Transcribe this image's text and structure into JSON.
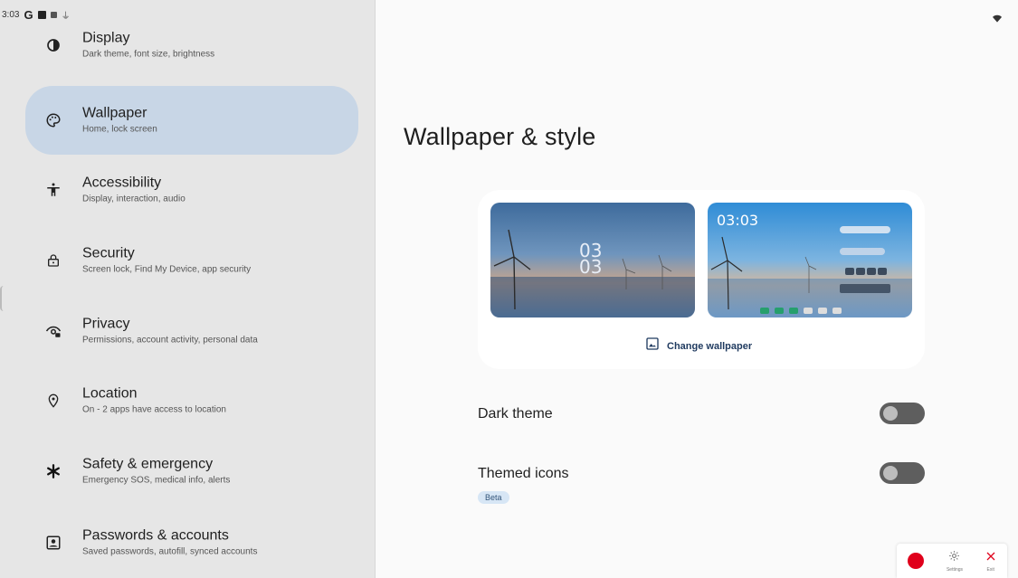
{
  "status_bar": {
    "time": "3:03",
    "g_label": "G"
  },
  "nav": {
    "items": [
      {
        "title": "Display",
        "subtitle": "Dark theme, font size, brightness",
        "icon": "brightness-icon"
      },
      {
        "title": "Wallpaper",
        "subtitle": "Home, lock screen",
        "icon": "palette-icon",
        "active": true
      },
      {
        "title": "Accessibility",
        "subtitle": "Display, interaction, audio",
        "icon": "accessibility-icon"
      },
      {
        "title": "Security",
        "subtitle": "Screen lock, Find My Device, app security",
        "icon": "lock-icon"
      },
      {
        "title": "Privacy",
        "subtitle": "Permissions, account activity, personal data",
        "icon": "privacy-eye-icon"
      },
      {
        "title": "Location",
        "subtitle": "On - 2 apps have access to location",
        "icon": "location-pin-icon"
      },
      {
        "title": "Safety & emergency",
        "subtitle": "Emergency SOS, medical info, alerts",
        "icon": "asterisk-icon"
      },
      {
        "title": "Passwords & accounts",
        "subtitle": "Saved passwords, autofill, synced accounts",
        "icon": "account-box-icon"
      }
    ]
  },
  "main": {
    "title": "Wallpaper & style",
    "lock_preview": {
      "clock_top": "03",
      "clock_bottom": "03"
    },
    "home_preview": {
      "clock": "03:03"
    },
    "change_wallpaper_label": "Change wallpaper",
    "settings": [
      {
        "label": "Dark theme",
        "enabled": false
      },
      {
        "label": "Themed icons",
        "enabled": false,
        "badge": "Beta"
      }
    ]
  },
  "recorder": {
    "settings_label": "Settings",
    "exit_label": "Exit",
    "record_color": "#e0001b"
  },
  "colors": {
    "nav_bg": "#e6e6e6",
    "nav_active": "#c8d6e6",
    "main_bg": "#fafafa",
    "toggle_off": "#5e5e5e"
  }
}
